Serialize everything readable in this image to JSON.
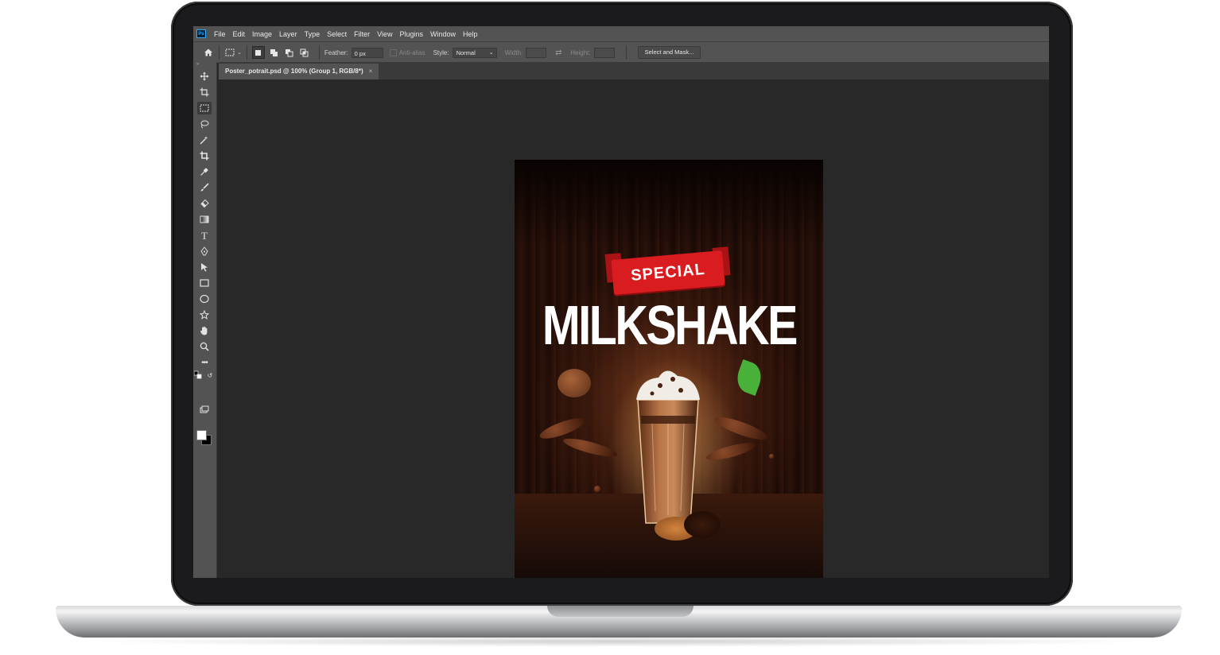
{
  "app": {
    "logo_text": "Ps",
    "menu": [
      "File",
      "Edit",
      "Image",
      "Layer",
      "Type",
      "Select",
      "Filter",
      "View",
      "Plugins",
      "Window",
      "Help"
    ]
  },
  "options": {
    "feather_label": "Feather:",
    "feather_value": "0 px",
    "antialias_label": "Anti-alias",
    "style_label": "Style:",
    "style_value": "Normal",
    "width_label": "Width:",
    "height_label": "Height:",
    "select_mask_label": "Select and Mask..."
  },
  "document": {
    "tab_title": "Poster_potrait.psd @ 100% (Group 1, RGB/8*)",
    "close_glyph": "×"
  },
  "poster": {
    "ribbon_text": "SPECIAL",
    "title": "MILKSHAKE"
  },
  "colors": {
    "foreground": "#ffffff",
    "background": "#000000",
    "ribbon": "#d81c1f"
  },
  "tools": [
    "move-icon",
    "artboard-icon",
    "marquee-icon",
    "lasso-icon",
    "magic-wand-icon",
    "crop-icon",
    "eyedropper-icon",
    "brush-icon",
    "eraser-icon",
    "gradient-icon",
    "type-icon",
    "pen-icon",
    "path-select-icon",
    "rectangle-icon",
    "ellipse-icon",
    "custom-shape-icon",
    "hand-icon",
    "zoom-icon",
    "more-tools-icon"
  ]
}
